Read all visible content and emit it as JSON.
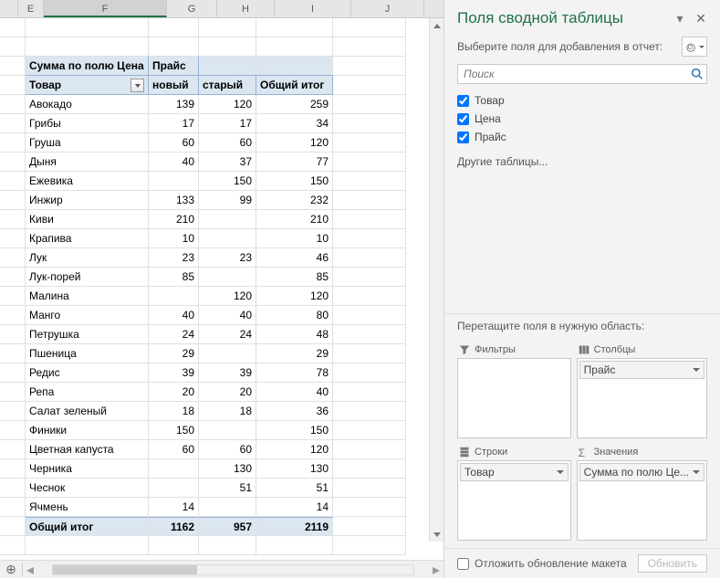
{
  "columns": [
    "E",
    "F",
    "G",
    "H",
    "I",
    "J"
  ],
  "selected_col": "F",
  "pivot": {
    "header_label": "Сумма по полю Цена",
    "col_field": "Прайс",
    "row_field": "Товар",
    "col_values": [
      "новый",
      "старый"
    ],
    "grand_col_label": "Общий итог",
    "grand_row_label": "Общий итог",
    "rows": [
      {
        "label": "Авокадо",
        "v": [
          139,
          120,
          259
        ]
      },
      {
        "label": "Грибы",
        "v": [
          17,
          17,
          34
        ]
      },
      {
        "label": "Груша",
        "v": [
          60,
          60,
          120
        ]
      },
      {
        "label": "Дыня",
        "v": [
          40,
          37,
          77
        ]
      },
      {
        "label": "Ежевика",
        "v": [
          null,
          150,
          150
        ]
      },
      {
        "label": "Инжир",
        "v": [
          133,
          99,
          232
        ]
      },
      {
        "label": "Киви",
        "v": [
          210,
          null,
          210
        ]
      },
      {
        "label": "Крапива",
        "v": [
          10,
          null,
          10
        ]
      },
      {
        "label": "Лук",
        "v": [
          23,
          23,
          46
        ]
      },
      {
        "label": "Лук-порей",
        "v": [
          85,
          null,
          85
        ]
      },
      {
        "label": "Малина",
        "v": [
          null,
          120,
          120
        ]
      },
      {
        "label": "Манго",
        "v": [
          40,
          40,
          80
        ]
      },
      {
        "label": "Петрушка",
        "v": [
          24,
          24,
          48
        ]
      },
      {
        "label": "Пшеница",
        "v": [
          29,
          null,
          29
        ]
      },
      {
        "label": "Редис",
        "v": [
          39,
          39,
          78
        ]
      },
      {
        "label": "Репа",
        "v": [
          20,
          20,
          40
        ]
      },
      {
        "label": "Салат зеленый",
        "v": [
          18,
          18,
          36
        ]
      },
      {
        "label": "Финики",
        "v": [
          150,
          null,
          150
        ]
      },
      {
        "label": "Цветная капуста",
        "v": [
          60,
          60,
          120
        ]
      },
      {
        "label": "Черника",
        "v": [
          null,
          130,
          130
        ]
      },
      {
        "label": "Чеснок",
        "v": [
          null,
          51,
          51
        ]
      },
      {
        "label": "Ячмень",
        "v": [
          14,
          null,
          14
        ]
      }
    ],
    "totals": [
      1162,
      957,
      2119
    ]
  },
  "pane": {
    "title": "Поля сводной таблицы",
    "prompt": "Выберите поля для добавления в отчет:",
    "search_placeholder": "Поиск",
    "fields": [
      {
        "name": "Товар",
        "checked": true
      },
      {
        "name": "Цена",
        "checked": true
      },
      {
        "name": "Прайс",
        "checked": true
      }
    ],
    "other_tables": "Другие таблицы...",
    "drag_prompt": "Перетащите поля в нужную область:",
    "areas": {
      "filters": {
        "title": "Фильтры",
        "items": []
      },
      "columns": {
        "title": "Столбцы",
        "items": [
          "Прайс"
        ]
      },
      "rows": {
        "title": "Строки",
        "items": [
          "Товар"
        ]
      },
      "values": {
        "title": "Значения",
        "items": [
          "Сумма по полю Це..."
        ]
      }
    },
    "defer_label": "Отложить обновление макета",
    "update_btn": "Обновить"
  }
}
